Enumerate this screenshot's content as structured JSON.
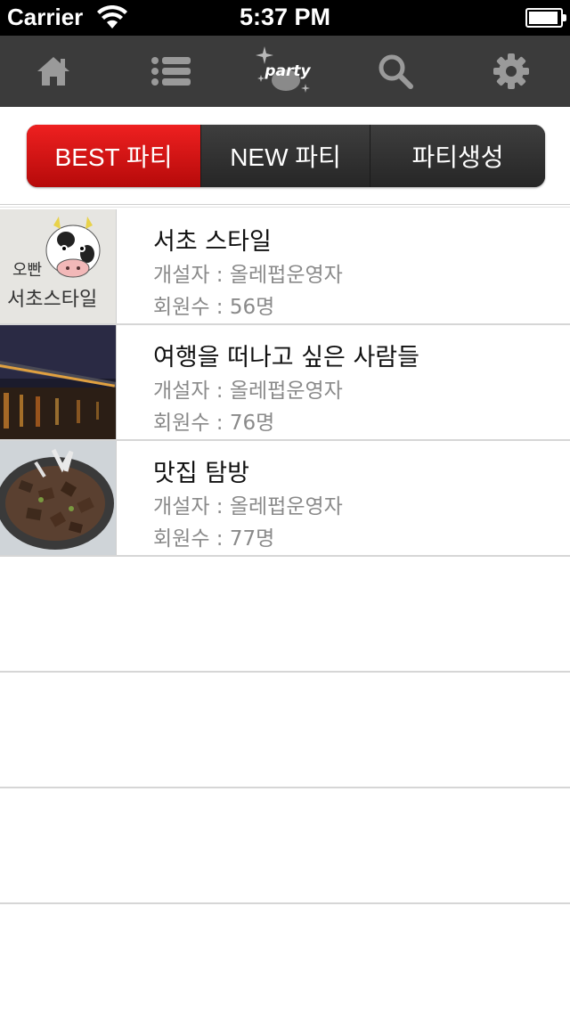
{
  "status_bar": {
    "carrier": "Carrier",
    "time": "5:37 PM",
    "battery_level": 0.95
  },
  "toolbar": {
    "icons": [
      "home-icon",
      "list-icon",
      "party-logo",
      "search-icon",
      "gear-icon"
    ],
    "logo_text": "party",
    "background": "#3b3b3b"
  },
  "segments": [
    {
      "label": "BEST 파티",
      "active": true
    },
    {
      "label": "NEW 파티",
      "active": false
    },
    {
      "label": "파티생성",
      "active": false
    }
  ],
  "accent_color": "#e01414",
  "parties": [
    {
      "title": "서초 스타일",
      "owner": "개설자 : 올레펍운영자",
      "members": "회원수 : 56명",
      "thumb_text": "오빤 서초스타일"
    },
    {
      "title": "여행을 떠나고 싶은 사람들",
      "owner": "개설자 : 올레펍운영자",
      "members": "회원수 : 76명"
    },
    {
      "title": "맛집 탐방",
      "owner": "개설자 : 올레펍운영자",
      "members": "회원수 : 77명"
    }
  ]
}
